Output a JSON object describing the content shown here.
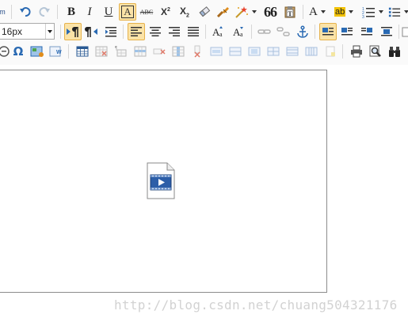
{
  "toolbar": {
    "font_size_value": "16px",
    "row1": {
      "partial_label": "m",
      "bold_label": "B",
      "italic_label": "I",
      "underline_label": "U",
      "font_border_label": "A",
      "strikethrough_label": "ABC",
      "superscript_label": "X",
      "subscript_label": "X",
      "quote_label": "66",
      "fore_color_label": "A",
      "back_color_label": "ab"
    },
    "row2": {
      "ltr_active": true,
      "justify_left_active": true,
      "image_none_active": true
    },
    "colors": {
      "active_bg": "#fbe3a7",
      "active_border": "#e6b24c",
      "icon_blue": "#2a6ab3",
      "icon_orange": "#e08c1a"
    }
  },
  "editor": {
    "embedded_item": "video-file-icon"
  },
  "watermark": {
    "text": "http://blog.csdn.net/chuang504321176"
  }
}
